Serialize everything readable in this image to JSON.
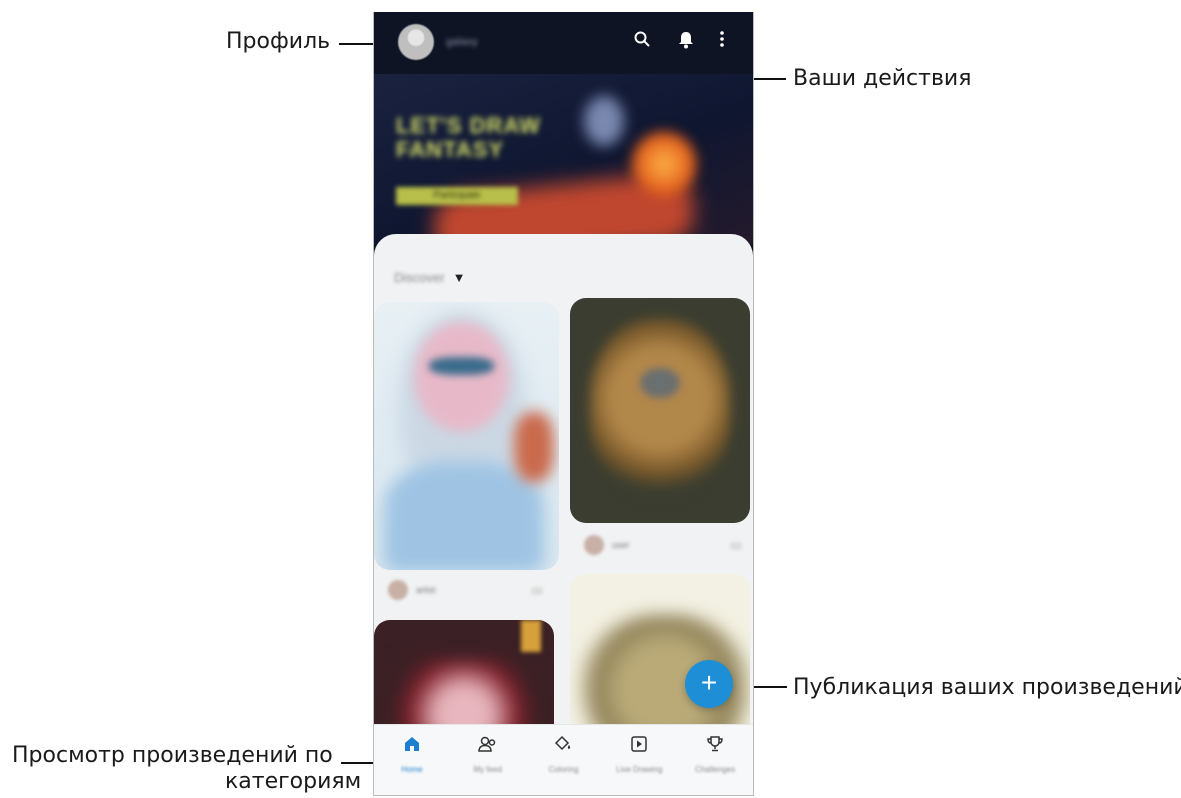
{
  "callouts": {
    "profile": "Профиль",
    "activity": "Ваши действия",
    "publish": "Публикация ваших произведений",
    "browse_line1": "Просмотр произведений по",
    "browse_line2": "категориям"
  },
  "app": {
    "username": "galaxy",
    "icons": {
      "search": "search-icon",
      "bell": "bell-icon",
      "more": "more-vertical-icon"
    },
    "banner": {
      "title": "LET'S DRAW FANTASY",
      "button": "Participate"
    },
    "filter": {
      "selected": "Discover"
    },
    "cards": [
      {
        "author": "artist"
      },
      {
        "author": "user"
      }
    ],
    "fab_icon": "plus-icon",
    "nav": [
      {
        "label": "Home",
        "icon": "home-icon",
        "active": true
      },
      {
        "label": "My feed",
        "icon": "people-icon",
        "active": false
      },
      {
        "label": "Coloring",
        "icon": "paint-bucket-icon",
        "active": false
      },
      {
        "label": "Live Drawing",
        "icon": "play-icon",
        "active": false
      },
      {
        "label": "Challenges",
        "icon": "trophy-icon",
        "active": false
      }
    ],
    "accent": "#1e8fd6"
  }
}
